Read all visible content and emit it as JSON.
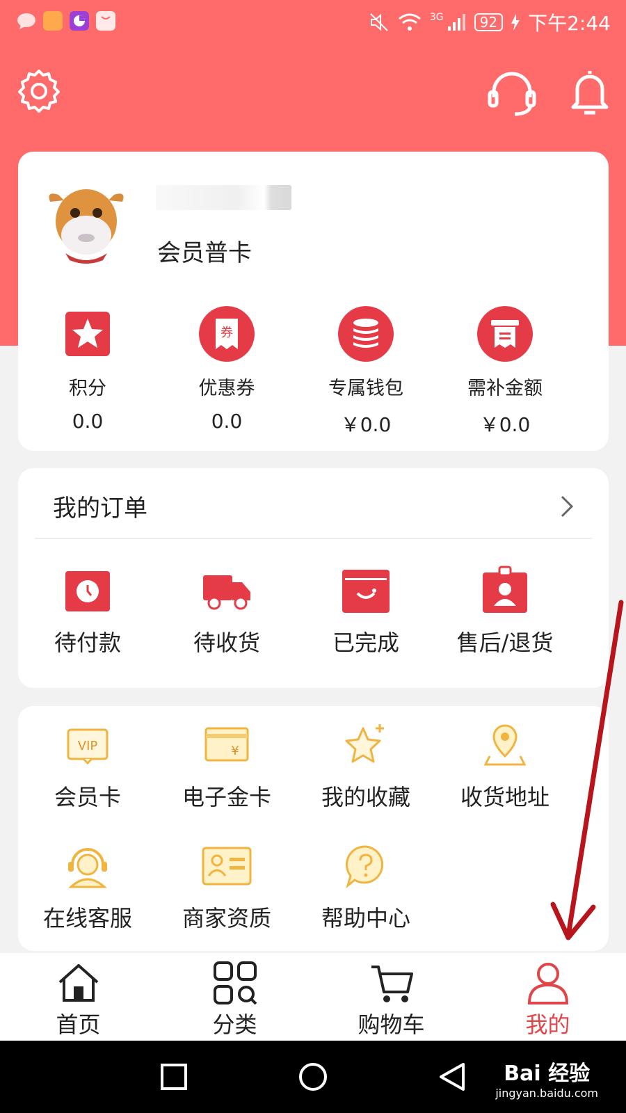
{
  "status_bar": {
    "network": "3G",
    "battery": "92",
    "time": "下午2:44"
  },
  "profile": {
    "member_level": "会员普卡"
  },
  "assets": [
    {
      "label": "积分",
      "value": "0.0",
      "icon": "star-icon"
    },
    {
      "label": "优惠券",
      "value": "0.0",
      "icon": "coupon-icon"
    },
    {
      "label": "专属钱包",
      "value": "￥0.0",
      "icon": "coins-icon"
    },
    {
      "label": "需补金额",
      "value": "￥0.0",
      "icon": "receipt-icon"
    }
  ],
  "orders": {
    "title": "我的订单",
    "items": [
      {
        "label": "待付款",
        "icon": "clock-icon"
      },
      {
        "label": "待收货",
        "icon": "truck-icon"
      },
      {
        "label": "已完成",
        "icon": "wallet-smile-icon"
      },
      {
        "label": "售后/退货",
        "icon": "badge-person-icon"
      }
    ]
  },
  "services": [
    {
      "label": "会员卡",
      "icon": "vip-card-icon"
    },
    {
      "label": "电子金卡",
      "icon": "gold-card-icon"
    },
    {
      "label": "我的收藏",
      "icon": "star-outline-icon"
    },
    {
      "label": "收货地址",
      "icon": "location-pin-icon"
    },
    {
      "label": "在线客服",
      "icon": "customer-service-icon"
    },
    {
      "label": "商家资质",
      "icon": "id-card-icon"
    },
    {
      "label": "帮助中心",
      "icon": "help-icon"
    }
  ],
  "bottom_nav": [
    {
      "label": "首页",
      "icon": "home-icon",
      "active": false
    },
    {
      "label": "分类",
      "icon": "category-icon",
      "active": false
    },
    {
      "label": "购物车",
      "icon": "cart-icon",
      "active": false
    },
    {
      "label": "我的",
      "icon": "person-icon",
      "active": true
    }
  ],
  "watermark": {
    "brand": "Bai 经验",
    "url": "jingyan.baidu.com"
  },
  "colors": {
    "header": "#ff6b6b",
    "accent_red": "#e53b46",
    "gold": "#f0b440",
    "active_tab": "#e0454a",
    "annotation_arrow": "#b8141c"
  }
}
